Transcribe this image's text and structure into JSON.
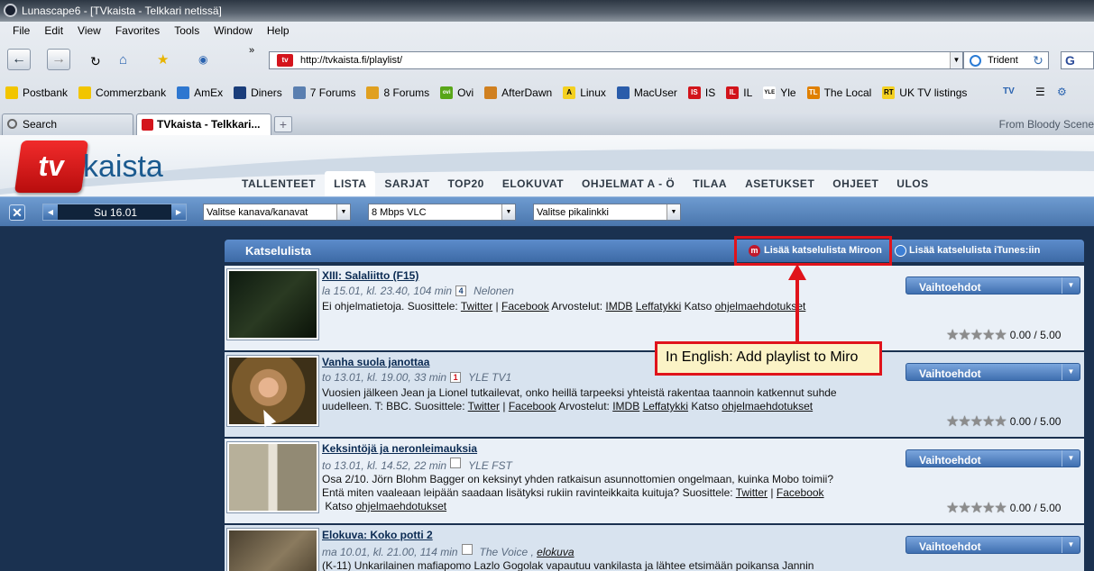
{
  "window": {
    "title": "Lunascape6 - [TVkaista - Telkkari netissä]"
  },
  "menu": [
    "File",
    "Edit",
    "View",
    "Favorites",
    "Tools",
    "Window",
    "Help"
  ],
  "nav": {
    "overflow": "»",
    "url": "http://tvkaista.fi/playlist/",
    "engine": "Trident",
    "engine_refresh": "↻",
    "google": "G"
  },
  "bookmarks": [
    {
      "label": "Postbank",
      "icon": "postbank-icon",
      "color": "#f2c500"
    },
    {
      "label": "Commerzbank",
      "icon": "commerzbank-icon",
      "color": "#f2c500"
    },
    {
      "label": "AmEx",
      "icon": "amex-icon",
      "color": "#2e77d0"
    },
    {
      "label": "Diners",
      "icon": "diners-icon",
      "color": "#1a3d7a"
    },
    {
      "label": "7 Forums",
      "icon": "forums-icon",
      "color": "#5a7fb0"
    },
    {
      "label": "8 Forums",
      "icon": "forums-icon",
      "color": "#e0a020"
    },
    {
      "label": "Ovi",
      "icon": "ovi-icon",
      "color": "#58a618",
      "glyph": "ovi"
    },
    {
      "label": "AfterDawn",
      "icon": "afterdawn-icon",
      "color": "#d08020"
    },
    {
      "label": "Linux",
      "icon": "linux-icon",
      "color": "#f4d020",
      "glyph": "A"
    },
    {
      "label": "MacUser",
      "icon": "macuser-icon",
      "color": "#2a5caa"
    },
    {
      "label": "IS",
      "icon": "is-icon",
      "color": "#d2141b",
      "glyph": "IS"
    },
    {
      "label": "IL",
      "icon": "il-icon",
      "color": "#d2141b",
      "glyph": "IL"
    },
    {
      "label": "Yle",
      "icon": "yle-icon",
      "color": "#ffffff",
      "glyph": "YLE"
    },
    {
      "label": "The Local",
      "icon": "thelocal-icon",
      "color": "#e08000",
      "glyph": "TL"
    },
    {
      "label": "UK TV listings",
      "icon": "rt-icon",
      "color": "#f4d020",
      "glyph": "RT"
    }
  ],
  "tabs": [
    {
      "label": "Search"
    },
    {
      "label": "TVkaista - Telkkari..."
    }
  ],
  "new_tab": "+",
  "tab_right_text": "From Bloody Scene",
  "site": {
    "logo_tv": "tv",
    "logo_text": "kaista",
    "nav": [
      "TALLENTEET",
      "LISTA",
      "SARJAT",
      "TOP20",
      "ELOKUVAT",
      "OHJELMAT A - Ö",
      "TILAA",
      "ASETUKSET",
      "OHJEET",
      "ULOS"
    ],
    "active_nav": "LISTA",
    "close_glyph": "✕",
    "date": "Su 16.01",
    "channel_select": "Valitse kanava/kanavat",
    "quality_select": "8 Mbps VLC",
    "quicklink_select": "Valitse pikalinkki"
  },
  "playlist": {
    "title": "Katselulista",
    "miro_button": "Lisää katselulista Miroon",
    "itunes_button": "Lisää katselulista iTunes:iin",
    "options_label": "Vaihtoehdot",
    "rating_text": "0.00 / 5.00",
    "items": [
      {
        "title": "XIII: Salaliitto (F15)",
        "meta": "la 15.01, kl. 23.40, 104 min",
        "chnum": "4",
        "channel": "Nelonen",
        "desc_prefix": "Ei ohjelmatietoja. Suosittele: ",
        "links": [
          "Twitter",
          "Facebook",
          "IMDB",
          "Leffatykki",
          "ohjelmaehdotukset"
        ]
      },
      {
        "title": "Vanha suola janottaa",
        "meta": "to 13.01, kl. 19.00, 33 min",
        "chnum": "1",
        "channel": "YLE TV1",
        "desc_prefix": "Vuosien jälkeen Jean ja Lionel tutkailevat, onko heillä tarpeeksi yhteistä rakentaa taannoin katkennut suhde uudelleen. T: BBC. Suosittele: ",
        "links": [
          "Twitter",
          "Facebook",
          "IMDB",
          "Leffatykki",
          "ohjelmaehdotukset"
        ]
      },
      {
        "title": "Keksintöjä ja neronleimauksia",
        "meta": "to 13.01, kl. 14.52, 22 min",
        "chnum": "",
        "channel": "YLE FST",
        "desc_prefix": "Osa 2/10. Jörn Blohm Bagger on keksinyt yhden ratkaisun asunnottomien ongelmaan, kuinka Mobo toimii? Entä miten vaaleaan leipään saadaan lisätyksi rukiin ravinteikkaita kuituja? Suosittele: ",
        "links": [
          "Twitter",
          "Facebook",
          "ohjelmaehdotukset"
        ]
      },
      {
        "title": "Elokuva: Koko potti 2",
        "meta": "ma 10.01, kl. 21.00, 114 min",
        "chnum": "",
        "channel": "The Voice ,",
        "genre": "elokuva",
        "desc_prefix": "(K-11) Unkarilainen mafiapomo Lazlo Gogolak vapautuu vankilasta ja lähtee etsimään poikansa Jannin"
      }
    ]
  },
  "annotation": {
    "callout": "In English: Add playlist to Miro",
    "color": "#e0131b"
  },
  "words": {
    "arvostelut": " Arvostelut: ",
    "katso": " Katso ",
    "sep": " | "
  }
}
